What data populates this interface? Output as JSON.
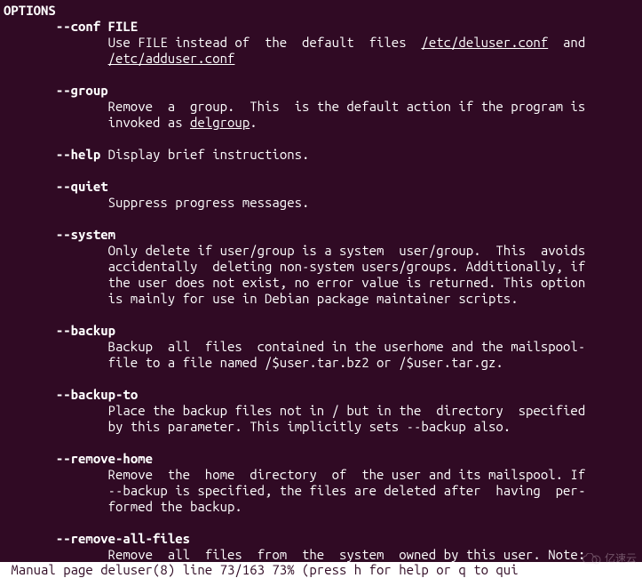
{
  "man": {
    "section_header": "OPTIONS",
    "options": {
      "conf": {
        "flag": "--conf",
        "arg": "FILE",
        "desc_pre": "Use FILE instead of  the  default  files  ",
        "file1": "/etc/deluser.conf",
        "mid": "  and",
        "file2": "/etc/adduser.conf"
      },
      "group": {
        "flag": "--group",
        "line1": "Remove  a  group.  This  is the default action if the program is",
        "line2_pre": "invoked as ",
        "cmd": "delgroup",
        "line2_post": "."
      },
      "help": {
        "flag": "--help",
        "desc": " Display brief instructions."
      },
      "quiet": {
        "flag": "--quiet",
        "line1": "Suppress progress messages."
      },
      "system": {
        "flag": "--system",
        "line1": "Only delete if user/group is a system  user/group.  This  avoids",
        "line2": "accidentally  deleting non-system users/groups. Additionally, if",
        "line3": "the user does not exist, no error value is returned. This option",
        "line4": "is mainly for use in Debian package maintainer scripts."
      },
      "backup": {
        "flag": "--backup",
        "line1": "Backup  all  files  contained in the userhome and the mailspool-",
        "line2": "file to a file named /$user.tar.bz2 or /$user.tar.gz."
      },
      "backup_to": {
        "flag": "--backup-to",
        "line1": "Place the backup files not in / but in the  directory  specified",
        "line2": "by this parameter. This implicitly sets --backup also."
      },
      "remove_home": {
        "flag": "--remove-home",
        "line1": "Remove  the  home  directory  of  the user and its mailspool. If",
        "line2": "--backup is specified, the files are deleted after  having  per‐",
        "line3": "formed the backup."
      },
      "remove_all_files": {
        "flag": "--remove-all-files",
        "line1": "Remove  all  files  from  the  system  owned by this user. Note:"
      }
    }
  },
  "status_bar": " Manual page deluser(8) line 73/163 73% (press h for help or q to qui",
  "watermark": {
    "text": "亿速云"
  }
}
